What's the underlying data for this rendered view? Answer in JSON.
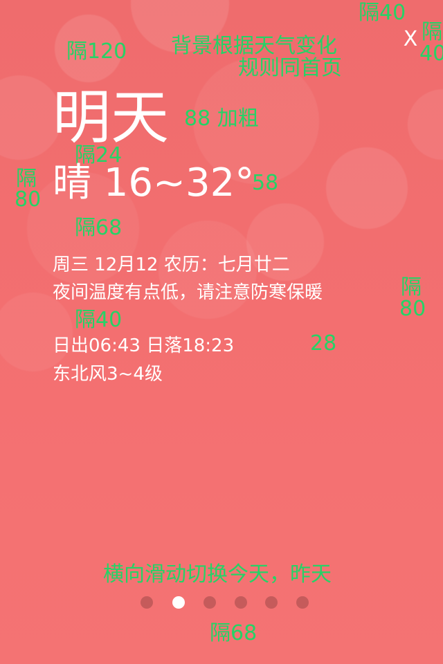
{
  "header": {
    "close_label": "X"
  },
  "weather": {
    "day_title": "明天",
    "condition_temp": "晴 16~32°",
    "date_line": "周三 12月12  农历：七月廿二",
    "tip_line": "夜间温度有点低，请注意防寒保暖",
    "sun_line": "日出06:43   日落18:23",
    "wind_line": "东北风3~4级"
  },
  "annotations": {
    "top_gap_right": "隔40",
    "gap_120": "隔120",
    "bg_note_line1": "背景根据天气变化",
    "bg_note_line2": "规则同首页",
    "close_gap_line1": "隔",
    "close_gap_line2": "40",
    "title_size": "88 加粗",
    "gap_24": "隔24",
    "left_gap_line1": "隔",
    "left_gap_line2": "80",
    "temp_size": "58",
    "gap_68_upper": "隔68",
    "right_gap_line1": "隔",
    "right_gap_line2": "80",
    "gap_40_middle": "隔40",
    "info_size": "28",
    "swipe_note": "横向滑动切换今天，昨天",
    "gap_68_bottom": "隔68"
  },
  "pagination": {
    "count": 6,
    "active_index": 1
  },
  "colors": {
    "background": "#f26e6e",
    "annotation": "#25d366",
    "text": "#ffffff"
  }
}
